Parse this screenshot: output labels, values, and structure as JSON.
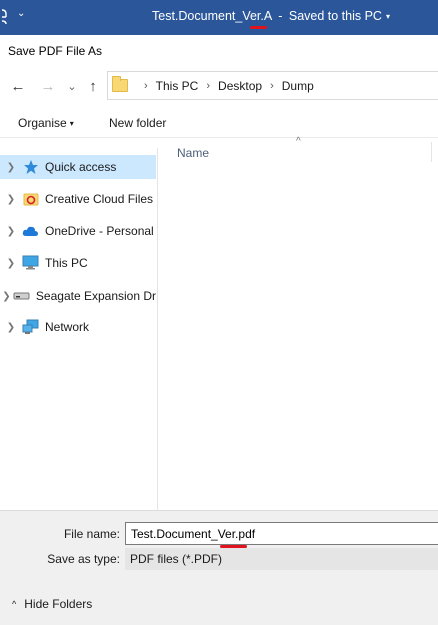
{
  "titlebar": {
    "quick_access_menu": "⌄",
    "document_name": "Test.Document_Ver.A",
    "separator": "-",
    "save_state": "Saved to this PC",
    "save_state_caret": "▾",
    "bg_color": "#2b579a",
    "annotation_color": "#e0141e"
  },
  "dialog": {
    "title": "Save PDF File As"
  },
  "navigation": {
    "back": "←",
    "forward": "→",
    "recent": "⌄",
    "up": "↑"
  },
  "address_bar": {
    "crumbs": [
      "This PC",
      "Desktop",
      "Dump"
    ],
    "separator": "›"
  },
  "toolbar": {
    "organise": "Organise",
    "organise_caret": "▾",
    "new_folder": "New folder"
  },
  "nav_pane": {
    "items": [
      {
        "label": "Quick access",
        "icon": "star-icon",
        "selected": true
      },
      {
        "label": "Creative Cloud Files",
        "icon": "creative-cloud-icon",
        "selected": false
      },
      {
        "label": "OneDrive - Personal",
        "icon": "cloud-icon",
        "selected": false
      },
      {
        "label": "This PC",
        "icon": "monitor-icon",
        "selected": false
      },
      {
        "label": "Seagate Expansion Dr",
        "icon": "drive-icon",
        "selected": false
      },
      {
        "label": "Network",
        "icon": "network-icon",
        "selected": false
      }
    ],
    "selected_color": "#cce8ff"
  },
  "file_list": {
    "column_name": "Name",
    "sort_indicator": "^"
  },
  "save_panel": {
    "file_name_label": "File name:",
    "file_name_value": "Test.Document_Ver.pdf",
    "save_as_type_label": "Save as type:",
    "save_as_type_value": "PDF files (*.PDF)",
    "hide_folders": "Hide Folders",
    "hide_folders_icon": "^"
  }
}
